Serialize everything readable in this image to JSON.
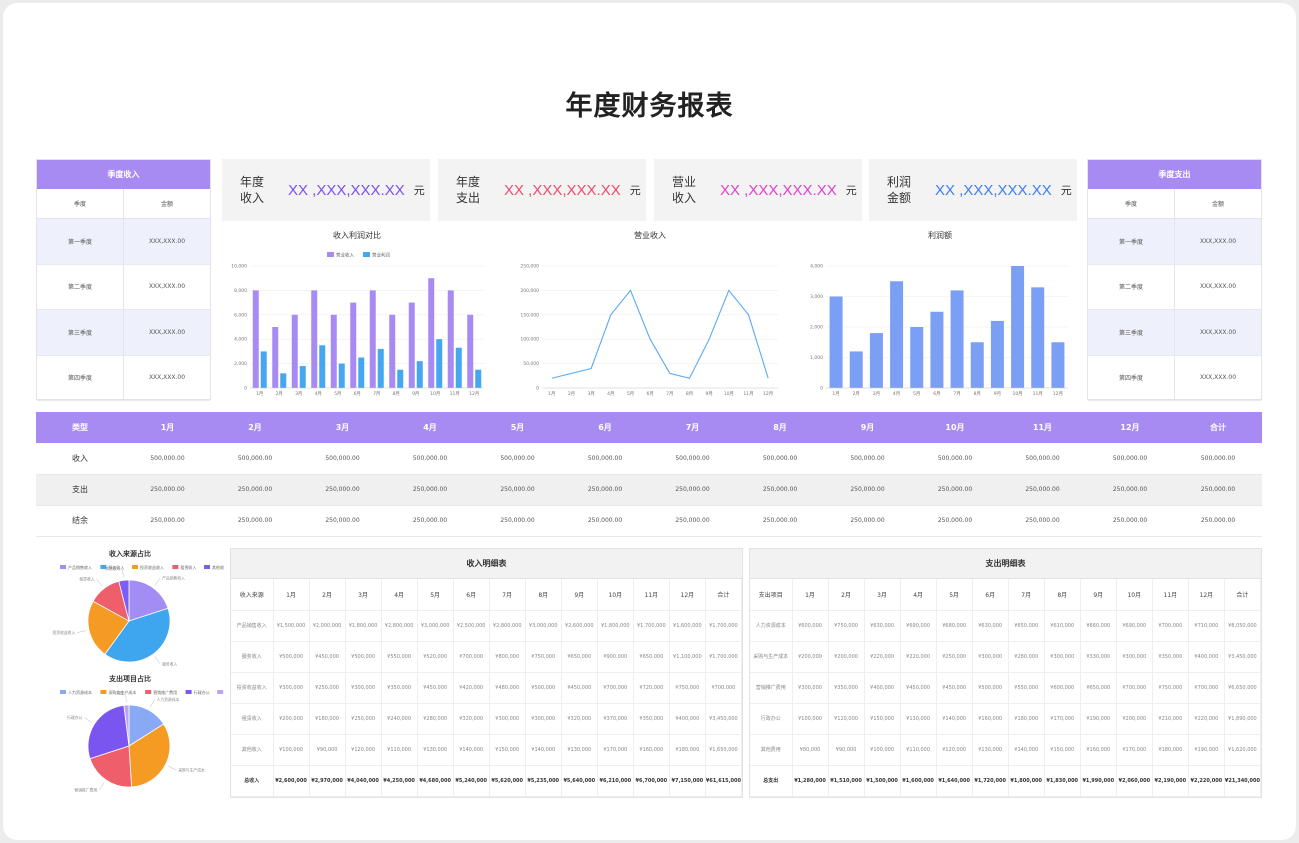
{
  "title": "年度财务报表",
  "colors": {
    "purple": "#a88bf2",
    "blue": "#45a7ef",
    "bar_blue": "#7b9ff5",
    "line_blue": "#5aa9f5"
  },
  "left_table": {
    "header": "季度收入",
    "col1": "季度",
    "col2": "金额",
    "rows": [
      {
        "q": "第一季度",
        "v": "XXX,XXX.00"
      },
      {
        "q": "第二季度",
        "v": "XXX,XXX.00"
      },
      {
        "q": "第三季度",
        "v": "XXX,XXX.00"
      },
      {
        "q": "第四季度",
        "v": "XXX,XXX.00"
      }
    ]
  },
  "right_table": {
    "header": "季度支出",
    "col1": "季度",
    "col2": "金额",
    "rows": [
      {
        "q": "第一季度",
        "v": "XXX,XXX.00"
      },
      {
        "q": "第二季度",
        "v": "XXX,XXX.00"
      },
      {
        "q": "第三季度",
        "v": "XXX,XXX.00"
      },
      {
        "q": "第四季度",
        "v": "XXX,XXX.00"
      }
    ]
  },
  "kpis": [
    {
      "l1": "年度",
      "l2": "收入",
      "value": "XX ,XXX,XXX.XX",
      "unit": "元",
      "color": "#7b4ff0"
    },
    {
      "l1": "年度",
      "l2": "支出",
      "value": "XX ,XXX,XXX.XX",
      "unit": "元",
      "color": "#ef4a6d"
    },
    {
      "l1": "营业",
      "l2": "收入",
      "value": "XX ,XXX,XXX.XX",
      "unit": "元",
      "color": "#e040d0"
    },
    {
      "l1": "利润",
      "l2": "金额",
      "value": "XX ,XXX,XXX.XX",
      "unit": "元",
      "color": "#3f7ef0"
    }
  ],
  "chart_data": [
    {
      "type": "bar",
      "title": "收入利润对比",
      "categories": [
        "1月",
        "2月",
        "3月",
        "4月",
        "5月",
        "6月",
        "7月",
        "8月",
        "9月",
        "10月",
        "11月",
        "12月"
      ],
      "series": [
        {
          "name": "营业收入",
          "values": [
            8000,
            5000,
            6000,
            8000,
            6000,
            7000,
            8000,
            6000,
            7000,
            9000,
            8000,
            6000
          ]
        },
        {
          "name": "营业利润",
          "values": [
            3000,
            1200,
            1800,
            3500,
            2000,
            2500,
            3200,
            1500,
            2200,
            4000,
            3300,
            1500
          ]
        }
      ],
      "ylim": [
        0,
        10000
      ],
      "yticks": [
        "0",
        "2,000",
        "4,000",
        "6,000",
        "8,000",
        "10,000"
      ],
      "legend": "top"
    },
    {
      "type": "line",
      "title": "营业收入",
      "categories": [
        "1月",
        "2月",
        "3月",
        "4月",
        "5月",
        "6月",
        "7月",
        "8月",
        "9月",
        "10月",
        "11月",
        "12月"
      ],
      "values": [
        20000,
        30000,
        40000,
        150000,
        200000,
        100000,
        30000,
        20000,
        100000,
        200000,
        150000,
        20000
      ],
      "ylim": [
        0,
        250000
      ],
      "yticks": [
        "0",
        "50,000",
        "100,000",
        "150,000",
        "200,000",
        "250,000"
      ]
    },
    {
      "type": "bar",
      "title": "利润额",
      "categories": [
        "1月",
        "2月",
        "3月",
        "4月",
        "5月",
        "6月",
        "7月",
        "8月",
        "9月",
        "10月",
        "11月",
        "12月"
      ],
      "values": [
        3000,
        1200,
        1800,
        3500,
        2000,
        2500,
        3200,
        1500,
        2200,
        4000,
        3300,
        1500
      ],
      "ylim": [
        0,
        4000
      ],
      "yticks": [
        "0",
        "1,000",
        "2,000",
        "3,000",
        "4,000"
      ]
    },
    {
      "type": "pie",
      "title": "收入来源占比",
      "labels": [
        "产品销售收入",
        "服务收入",
        "投资收益收入",
        "租赁收入",
        "其他收入"
      ],
      "values": [
        20,
        40,
        23,
        13,
        4
      ],
      "colors": [
        "#a48cf5",
        "#3ea6ef",
        "#f59a23",
        "#ee5e6b",
        "#7b5ff0"
      ]
    },
    {
      "type": "pie",
      "title": "支出项目占比",
      "labels": [
        "人力资源成本",
        "采购与生产成本",
        "营销推广费用",
        "行政办公",
        "其他"
      ],
      "values": [
        16,
        33,
        21,
        28,
        2
      ],
      "colors": [
        "#8aa9f5",
        "#f59a23",
        "#ee5e6b",
        "#7a55f0",
        "#b8a6f5"
      ]
    }
  ],
  "monthly": {
    "headers": [
      "类型",
      "1月",
      "2月",
      "3月",
      "4月",
      "5月",
      "6月",
      "7月",
      "8月",
      "9月",
      "10月",
      "11月",
      "12月",
      "合计"
    ],
    "rows": [
      {
        "label": "收入",
        "cells": [
          "500,000.00",
          "500,000.00",
          "500,000.00",
          "500,000.00",
          "500,000.00",
          "500,000.00",
          "500,000.00",
          "500,000.00",
          "500,000.00",
          "500,000.00",
          "500,000.00",
          "500,000.00",
          "500,000.00"
        ]
      },
      {
        "label": "支出",
        "cells": [
          "250,000.00",
          "250,000.00",
          "250,000.00",
          "250,000.00",
          "250,000.00",
          "250,000.00",
          "250,000.00",
          "250,000.00",
          "250,000.00",
          "250,000.00",
          "250,000.00",
          "250,000.00",
          "250,000.00"
        ]
      },
      {
        "label": "结余",
        "cells": [
          "250,000.00",
          "250,000.00",
          "250,000.00",
          "250,000.00",
          "250,000.00",
          "250,000.00",
          "250,000.00",
          "250,000.00",
          "250,000.00",
          "250,000.00",
          "250,000.00",
          "250,000.00",
          "250,000.00"
        ]
      }
    ]
  },
  "income_detail": {
    "title": "收入明细表",
    "headers": [
      "收入来源",
      "1月",
      "2月",
      "3月",
      "4月",
      "5月",
      "6月",
      "7月",
      "8月",
      "9月",
      "10月",
      "11月",
      "12月",
      "合计"
    ],
    "rows": [
      [
        "产品销售收入",
        "¥1,500,000",
        "¥2,000,000",
        "¥1,800,000",
        "¥2,800,000",
        "¥3,000,000",
        "¥2,500,000",
        "¥2,800,000",
        "¥3,000,000",
        "¥2,600,000",
        "¥1,800,000",
        "¥1,700,000",
        "¥1,600,000",
        "¥1,700,000"
      ],
      [
        "服务收入",
        "¥500,000",
        "¥450,000",
        "¥500,000",
        "¥550,000",
        "¥520,000",
        "¥700,000",
        "¥800,000",
        "¥750,000",
        "¥650,000",
        "¥900,000",
        "¥650,000",
        "¥1,100,000",
        "¥1,700,000"
      ],
      [
        "投资收益收入",
        "¥300,000",
        "¥250,000",
        "¥300,000",
        "¥350,000",
        "¥450,000",
        "¥420,000",
        "¥480,000",
        "¥500,000",
        "¥450,000",
        "¥700,000",
        "¥720,000",
        "¥750,000",
        "¥700,000"
      ],
      [
        "租赁收入",
        "¥200,000",
        "¥180,000",
        "¥250,000",
        "¥240,000",
        "¥280,000",
        "¥320,000",
        "¥300,000",
        "¥300,000",
        "¥320,000",
        "¥370,000",
        "¥350,000",
        "¥400,000",
        "¥3,450,000"
      ],
      [
        "其他收入",
        "¥100,000",
        "¥90,000",
        "¥120,000",
        "¥110,000",
        "¥130,000",
        "¥140,000",
        "¥150,000",
        "¥140,000",
        "¥130,000",
        "¥170,000",
        "¥160,000",
        "¥180,000",
        "¥1,650,000"
      ],
      [
        "总收入",
        "¥2,600,000",
        "¥2,970,000",
        "¥4,040,000",
        "¥4,250,000",
        "¥4,680,000",
        "¥5,240,000",
        "¥5,620,000",
        "¥5,235,000",
        "¥5,640,000",
        "¥6,210,000",
        "¥6,700,000",
        "¥7,150,000",
        "¥61,615,000"
      ]
    ]
  },
  "expense_detail": {
    "title": "支出明细表",
    "headers": [
      "支出项目",
      "1月",
      "2月",
      "3月",
      "4月",
      "5月",
      "6月",
      "7月",
      "8月",
      "9月",
      "10月",
      "11月",
      "12月",
      "合计"
    ],
    "rows": [
      [
        "人力资源成本",
        "¥600,000",
        "¥750,000",
        "¥630,000",
        "¥690,000",
        "¥680,000",
        "¥630,000",
        "¥650,000",
        "¥610,000",
        "¥660,000",
        "¥690,000",
        "¥700,000",
        "¥710,000",
        "¥8,050,000"
      ],
      [
        "采购与生产成本",
        "¥200,000",
        "¥200,000",
        "¥220,000",
        "¥220,000",
        "¥250,000",
        "¥300,000",
        "¥280,000",
        "¥300,000",
        "¥330,000",
        "¥300,000",
        "¥350,000",
        "¥400,000",
        "¥3,450,000"
      ],
      [
        "营销推广费用",
        "¥300,000",
        "¥350,000",
        "¥400,000",
        "¥450,000",
        "¥450,000",
        "¥500,000",
        "¥550,000",
        "¥600,000",
        "¥650,000",
        "¥700,000",
        "¥750,000",
        "¥700,000",
        "¥6,650,000"
      ],
      [
        "行政办公",
        "¥100,000",
        "¥120,000",
        "¥150,000",
        "¥130,000",
        "¥140,000",
        "¥160,000",
        "¥180,000",
        "¥170,000",
        "¥190,000",
        "¥200,000",
        "¥210,000",
        "¥220,000",
        "¥1,890,000"
      ],
      [
        "其他费用",
        "¥80,000",
        "¥90,000",
        "¥100,000",
        "¥110,000",
        "¥120,000",
        "¥130,000",
        "¥140,000",
        "¥150,000",
        "¥160,000",
        "¥170,000",
        "¥180,000",
        "¥190,000",
        "¥1,620,000"
      ],
      [
        "总支出",
        "¥1,280,000",
        "¥1,510,000",
        "¥1,500,000",
        "¥1,600,000",
        "¥1,640,000",
        "¥1,720,000",
        "¥1,800,000",
        "¥1,830,000",
        "¥1,990,000",
        "¥2,060,000",
        "¥2,190,000",
        "¥2,220,000",
        "¥21,340,000"
      ]
    ]
  }
}
